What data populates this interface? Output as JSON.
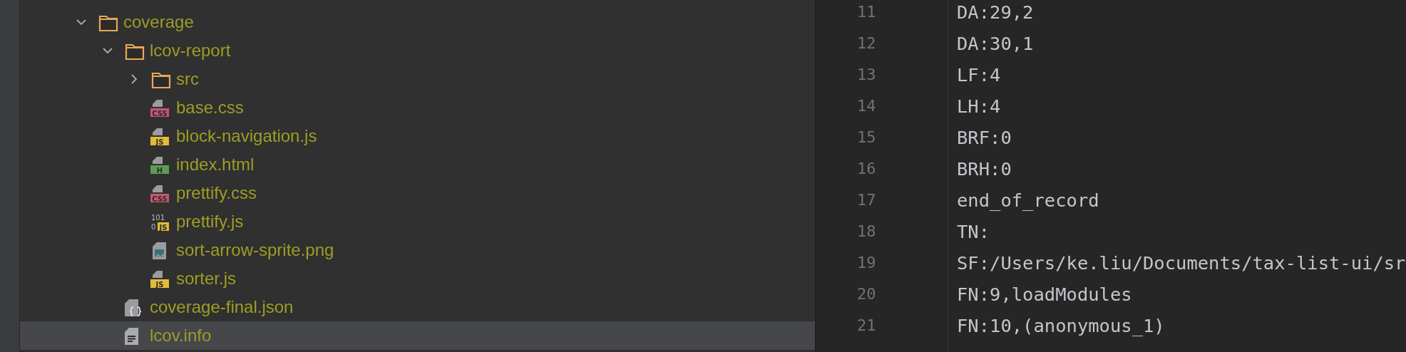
{
  "project_tree": {
    "items": [
      {
        "name": "coverage",
        "kind": "folder",
        "expanded": true,
        "selected": false,
        "children": [
          {
            "name": "lcov-report",
            "kind": "folder",
            "expanded": true,
            "selected": false,
            "children": [
              {
                "name": "src",
                "kind": "folder",
                "expanded": false,
                "selected": false
              },
              {
                "name": "base.css",
                "kind": "css",
                "badge": "CSS",
                "selected": false
              },
              {
                "name": "block-navigation.js",
                "kind": "js",
                "badge": "JS",
                "selected": false
              },
              {
                "name": "index.html",
                "kind": "html",
                "badge": "H",
                "selected": false
              },
              {
                "name": "prettify.css",
                "kind": "css",
                "badge": "CSS",
                "selected": false
              },
              {
                "name": "prettify.js",
                "kind": "binary",
                "badge": "JS",
                "bits": [
                  "101",
                  "0"
                ],
                "selected": false
              },
              {
                "name": "sort-arrow-sprite.png",
                "kind": "image",
                "selected": false
              },
              {
                "name": "sorter.js",
                "kind": "js",
                "badge": "JS",
                "selected": false
              }
            ]
          },
          {
            "name": "coverage-final.json",
            "kind": "json",
            "selected": false
          },
          {
            "name": "lcov.info",
            "kind": "text",
            "selected": true
          }
        ]
      }
    ]
  },
  "editor": {
    "lines": [
      {
        "number": "11",
        "text": "DA:29,2"
      },
      {
        "number": "12",
        "text": "DA:30,1"
      },
      {
        "number": "13",
        "text": "LF:4"
      },
      {
        "number": "14",
        "text": "LH:4"
      },
      {
        "number": "15",
        "text": "BRF:0"
      },
      {
        "number": "16",
        "text": "BRH:0"
      },
      {
        "number": "17",
        "text": "end_of_record"
      },
      {
        "number": "18",
        "text": "TN:"
      },
      {
        "number": "19",
        "text": "SF:/Users/ke.liu/Documents/tax-list-ui/sr"
      },
      {
        "number": "20",
        "text": "FN:9,loadModules"
      },
      {
        "number": "21",
        "text": "FN:10,(anonymous_1)"
      }
    ]
  }
}
